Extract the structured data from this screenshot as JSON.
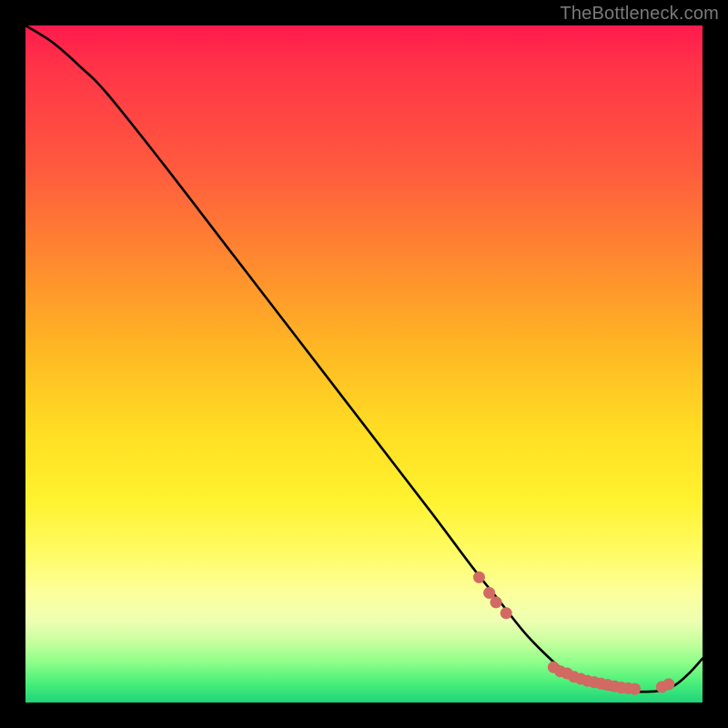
{
  "watermark": "TheBottleneck.com",
  "colors": {
    "background": "#000000",
    "curve_stroke": "#000000",
    "marker_fill": "#d16a63",
    "marker_stroke": "#b24f49"
  },
  "chart_data": {
    "type": "line",
    "title": "",
    "xlabel": "",
    "ylabel": "",
    "xlim": [
      0,
      100
    ],
    "ylim": [
      0,
      100
    ],
    "grid": false,
    "x": [
      0,
      4,
      8,
      12,
      20,
      30,
      40,
      50,
      60,
      66,
      70,
      74,
      78,
      80,
      82,
      84,
      86,
      88,
      90,
      92,
      94,
      96,
      98,
      100
    ],
    "y": [
      100,
      97.5,
      94,
      90,
      80,
      67,
      54,
      41,
      28,
      20,
      15,
      10,
      6,
      4.5,
      3.3,
      2.5,
      2.0,
      1.7,
      1.6,
      1.6,
      1.8,
      2.6,
      4.3,
      6.5
    ],
    "markers_x": [
      67,
      68.5,
      69.5,
      71,
      78,
      79,
      80,
      81,
      82,
      83,
      84,
      85,
      86,
      87,
      88,
      89,
      90,
      94,
      95
    ],
    "markers_y": [
      18.5,
      16.2,
      14.8,
      13.2,
      5.2,
      4.6,
      4.3,
      3.8,
      3.5,
      3.2,
      3.0,
      2.8,
      2.6,
      2.4,
      2.2,
      2.1,
      2.0,
      2.3,
      2.7
    ]
  }
}
